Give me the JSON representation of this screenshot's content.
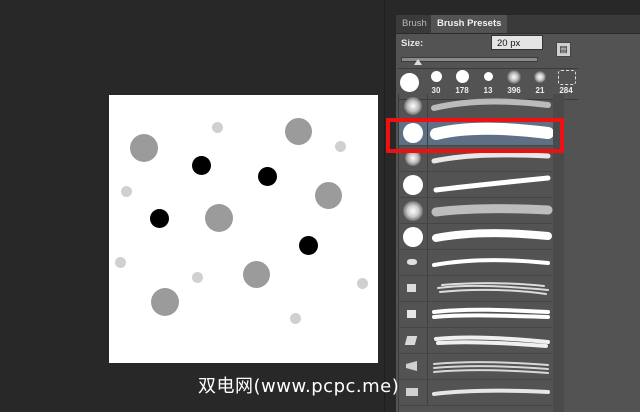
{
  "panel": {
    "tabs": [
      "Brush",
      "Brush Presets"
    ],
    "size_label": "Size:",
    "size_value": "20 px",
    "menu_icon": "panel-options-icon",
    "recent_sizes": [
      "30",
      "178",
      "13",
      "396",
      "21",
      "284"
    ]
  },
  "watermark": "双电网(www.pcpc.me)",
  "colors": {
    "background": "#282828",
    "panel": "#535353",
    "highlight": "#ee1111",
    "dot_gray": "#9a9a9a",
    "dot_light": "#d0d0d0",
    "dot_black": "#000000"
  }
}
